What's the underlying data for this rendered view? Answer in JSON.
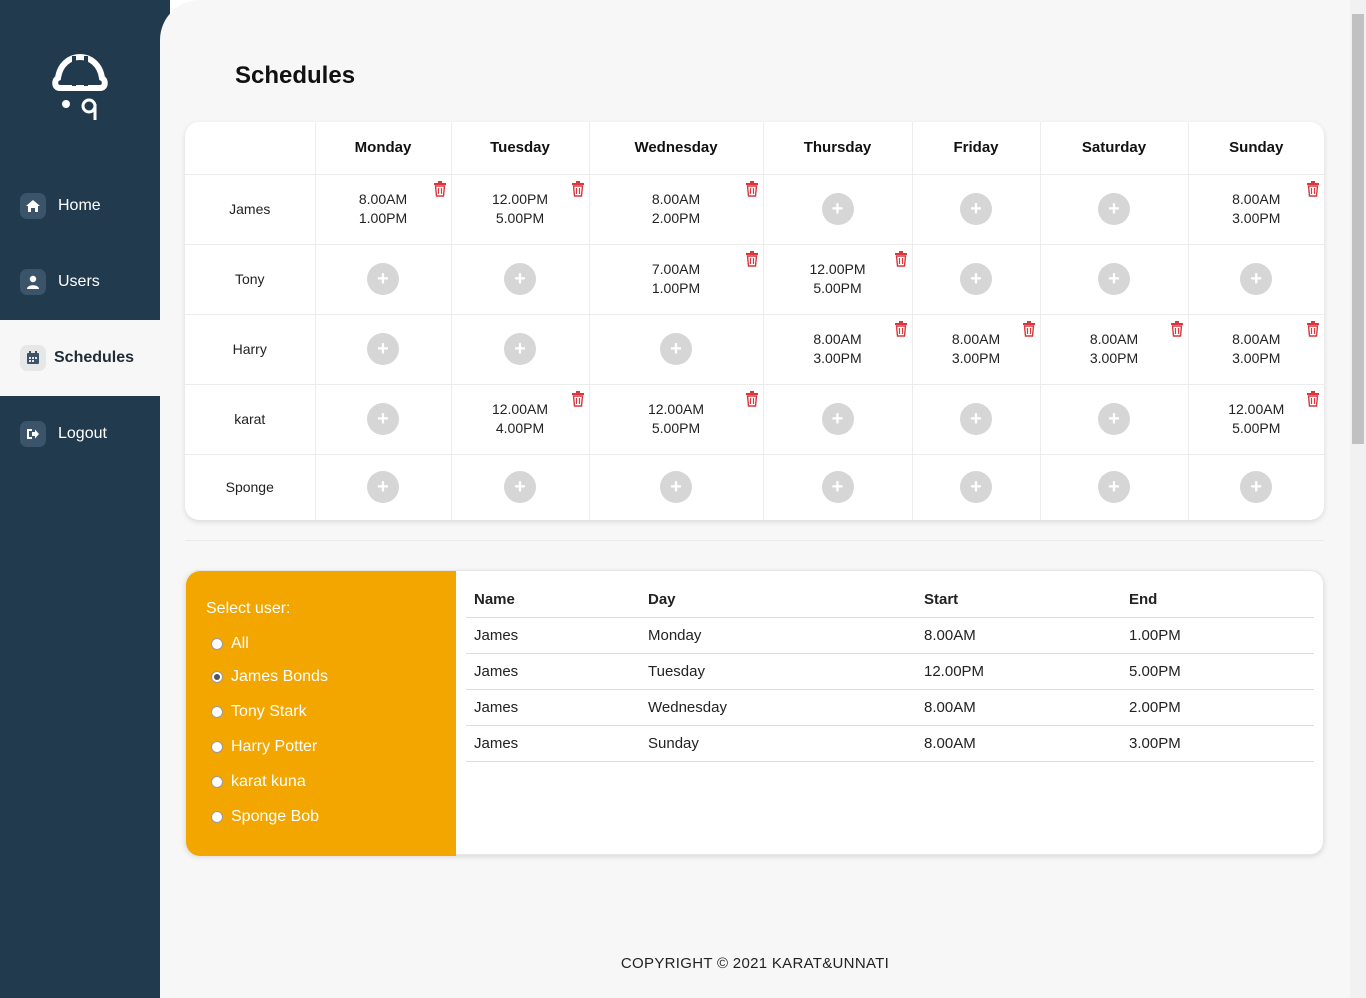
{
  "sidebar": {
    "items": [
      {
        "label": "Home",
        "icon": "home-icon"
      },
      {
        "label": "Users",
        "icon": "user-icon"
      },
      {
        "label": "Schedules",
        "icon": "calendar-icon"
      },
      {
        "label": "Logout",
        "icon": "logout-icon"
      }
    ]
  },
  "page": {
    "title": "Schedules"
  },
  "grid": {
    "days": [
      "Monday",
      "Tuesday",
      "Wednesday",
      "Thursday",
      "Friday",
      "Saturday",
      "Sunday"
    ],
    "rows": [
      {
        "name": "James",
        "cells": [
          [
            "8.00AM",
            "1.00PM"
          ],
          [
            "12.00PM",
            "5.00PM"
          ],
          [
            "8.00AM",
            "2.00PM"
          ],
          null,
          null,
          null,
          [
            "8.00AM",
            "3.00PM"
          ]
        ]
      },
      {
        "name": "Tony",
        "cells": [
          null,
          null,
          [
            "7.00AM",
            "1.00PM"
          ],
          [
            "12.00PM",
            "5.00PM"
          ],
          null,
          null,
          null
        ]
      },
      {
        "name": "Harry",
        "cells": [
          null,
          null,
          null,
          [
            "8.00AM",
            "3.00PM"
          ],
          [
            "8.00AM",
            "3.00PM"
          ],
          [
            "8.00AM",
            "3.00PM"
          ],
          [
            "8.00AM",
            "3.00PM"
          ]
        ]
      },
      {
        "name": "karat",
        "cells": [
          null,
          [
            "12.00AM",
            "4.00PM"
          ],
          [
            "12.00AM",
            "5.00PM"
          ],
          null,
          null,
          null,
          [
            "12.00AM",
            "5.00PM"
          ]
        ]
      },
      {
        "name": "Sponge",
        "cells": [
          null,
          null,
          null,
          null,
          null,
          null,
          null
        ]
      }
    ],
    "add_symbol": "+"
  },
  "selector": {
    "title": "Select user:",
    "options": [
      "All",
      "James Bonds",
      "Tony Stark",
      "Harry Potter",
      "karat kuna",
      "Sponge Bob"
    ],
    "selected": "James Bonds"
  },
  "list": {
    "headers": [
      "Name",
      "Day",
      "Start",
      "End"
    ],
    "rows": [
      [
        "James",
        "Monday",
        "8.00AM",
        "1.00PM"
      ],
      [
        "James",
        "Tuesday",
        "12.00PM",
        "5.00PM"
      ],
      [
        "James",
        "Wednesday",
        "8.00AM",
        "2.00PM"
      ],
      [
        "James",
        "Sunday",
        "8.00AM",
        "3.00PM"
      ]
    ]
  },
  "footer": {
    "text": "COPYRIGHT  ©  2021  KARAT&UNNATI"
  },
  "colors": {
    "sidebar": "#223a4e",
    "accent": "#f4a600",
    "delete": "#d9363e"
  }
}
